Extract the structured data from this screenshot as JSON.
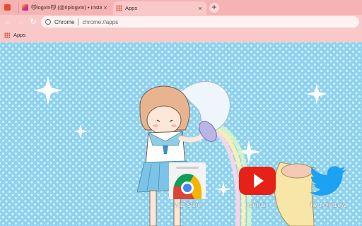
{
  "tabs": [
    {
      "title": "",
      "favicon": "bookmark-favicon-icon"
    },
    {
      "title": "😼logvin😼 (@riplogvin) • Instagram",
      "favicon": "instagram-icon"
    },
    {
      "title": "Apps",
      "favicon": "apps-grid-icon"
    }
  ],
  "toolbar": {
    "site_chip": "Chrome",
    "url": "chrome://apps"
  },
  "bookmarks": {
    "apps_label": "Apps"
  },
  "apps": [
    {
      "label": "Web Store",
      "icon": "chrome-web-store-icon"
    },
    {
      "label": "YouTube",
      "icon": "youtube-icon"
    },
    {
      "label": "Twitt @eltLeyz",
      "icon": "twitter-icon"
    }
  ],
  "colors": {
    "tabstrip": "#f6b3b3",
    "toolbar": "#f9c9c9",
    "page_background": "#8fd2ee",
    "youtube_red": "#e62117",
    "twitter_blue": "#1da1f2"
  }
}
